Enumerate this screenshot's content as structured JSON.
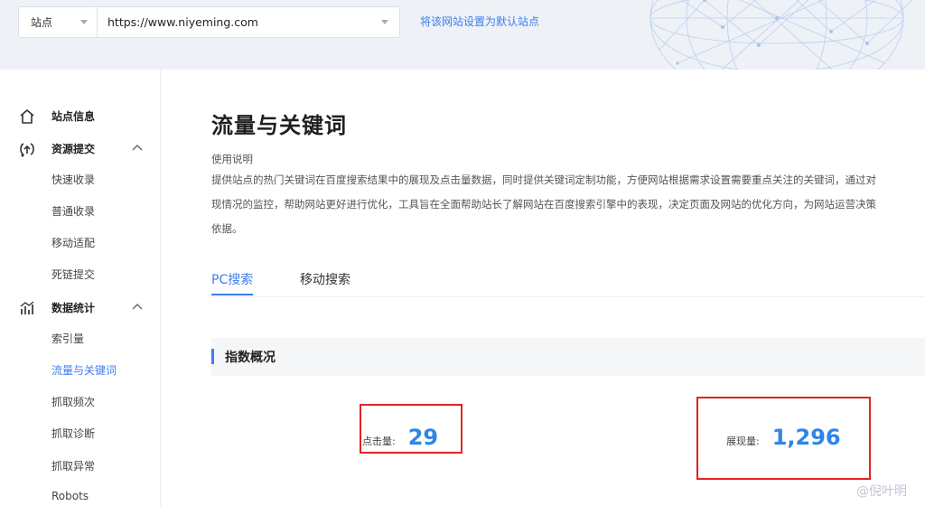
{
  "topbar": {
    "site_label": "站点",
    "url_value": "https://www.niyeming.com",
    "default_link": "将该网站设置为默认站点"
  },
  "sidebar": {
    "groups": [
      {
        "label": "站点信息",
        "icon": "home-icon"
      },
      {
        "label": "资源提交",
        "icon": "submit-icon",
        "expanded": true,
        "items": [
          "快速收录",
          "普通收录",
          "移动适配",
          "死链提交"
        ]
      },
      {
        "label": "数据统计",
        "icon": "stats-icon",
        "expanded": true,
        "items": [
          "索引量",
          "流量与关键词",
          "抓取频次",
          "抓取诊断",
          "抓取异常",
          "Robots"
        ]
      }
    ],
    "active_item": "流量与关键词"
  },
  "main": {
    "title": "流量与关键词",
    "usage_label": "使用说明",
    "description_lines": [
      "提供站点的热门关键词在百度搜索结果中的展现及点击量数据，同时提供关键词定制功能，方便网站根据需求设置需要重点关注的关键词，通过对",
      "现情况的监控，帮助网站更好进行优化，工具旨在全面帮助站长了解网站在百度搜索引擎中的表现，决定页面及网站的优化方向，为网站运营决策",
      "依据。"
    ],
    "tabs": [
      {
        "label": "PC搜索",
        "active": true
      },
      {
        "label": "移动搜索",
        "active": false
      }
    ],
    "section_title": "指数概况",
    "metrics": {
      "clicks_label": "点击量:",
      "clicks_value": "29",
      "impressions_label": "展现量:",
      "impressions_value": "1,296"
    }
  },
  "watermark": "@倪叶明",
  "colors": {
    "accent": "#3d7ef0",
    "metric_value": "#2f85e8",
    "highlight": "#e02424"
  }
}
